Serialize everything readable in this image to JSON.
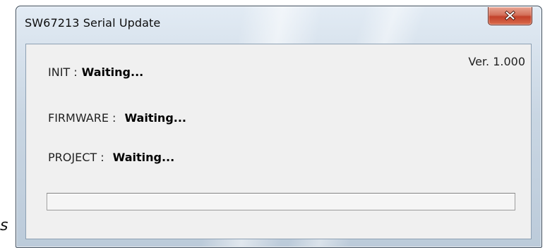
{
  "stray_text": "s",
  "window": {
    "title": "SW67213 Serial Update",
    "close_icon": "close-x-icon"
  },
  "content": {
    "version": "Ver. 1.000",
    "rows": [
      {
        "label": "INIT :",
        "value": "Waiting..."
      },
      {
        "label": "FIRMWARE :",
        "value": "Waiting..."
      },
      {
        "label": "PROJECT :",
        "value": "Waiting..."
      }
    ],
    "progress": {
      "value": 0
    }
  },
  "colors": {
    "close_button": "#c2412a",
    "client_background": "#f0f0f0",
    "frame": "#c9d6e3"
  }
}
